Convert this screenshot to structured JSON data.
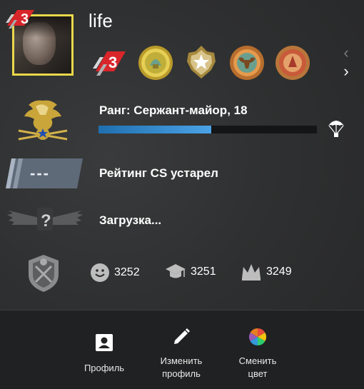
{
  "header": {
    "username": "life",
    "level_badge_number": "3"
  },
  "medals": [
    {
      "icon": "level-3-medal-icon",
      "label": "3"
    },
    {
      "icon": "gold-coin-medal-icon"
    },
    {
      "icon": "star-crest-medal-icon"
    },
    {
      "icon": "bull-coin-medal-icon"
    },
    {
      "icon": "red-gold-coin-medal-icon"
    }
  ],
  "carousel": {
    "prev_icon": "chevron-left-icon",
    "next_icon": "chevron-right-icon"
  },
  "rank": {
    "label": "Ранг: Сержант-майор, 18",
    "xp_progress": 0.516
  },
  "rating": {
    "badge_text": "---",
    "text": "Рейтинг CS устарел"
  },
  "wingman": {
    "badge_text": "?",
    "text": "Загрузка..."
  },
  "commendations": {
    "friendly": "3252",
    "teacher": "3251",
    "leader": "3249"
  },
  "footer": {
    "profile_line1": "Профиль",
    "edit_line1": "Изменить",
    "edit_line2": "профиль",
    "color_line1": "Сменить",
    "color_line2": "цвет"
  },
  "colors": {
    "avatar_border": "#e9d94a",
    "xp_fill": "#4aa3e6",
    "level_badge_red": "#d8262b"
  }
}
